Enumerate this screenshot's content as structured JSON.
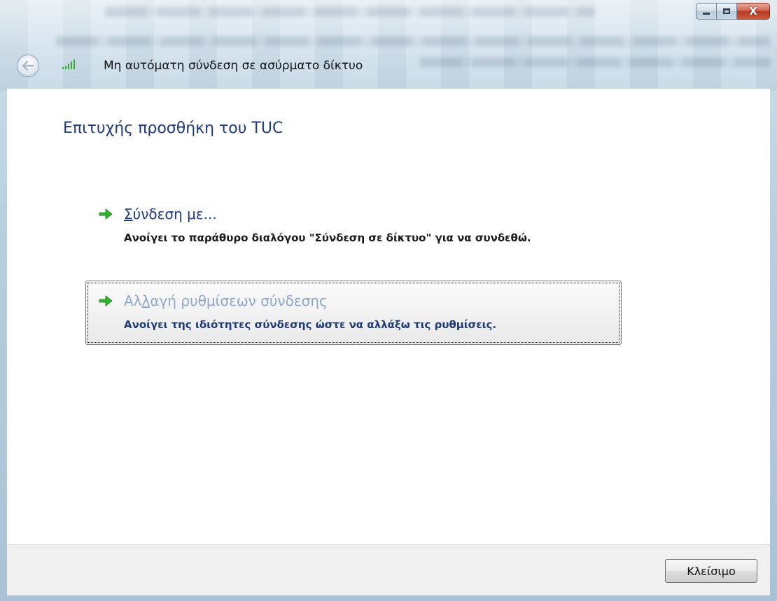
{
  "window": {
    "title": "Μη αυτόματη σύνδεση σε ασύρματο δίκτυο",
    "caption_buttons": [
      "minimize",
      "maximize",
      "close"
    ],
    "close_glyph": "X"
  },
  "nav": {
    "back_icon": "back-arrow-icon",
    "network_icon": "wireless-signal-icon"
  },
  "main": {
    "heading": "Επιτυχής προσθήκη του TUC",
    "commands": [
      {
        "title_underlined": "Σ",
        "title_rest": "ύνδεση με...",
        "description": "Ανοίγει το παράθυρο διαλόγου \"Σύνδεση σε δίκτυο\" για να συνδεθώ."
      },
      {
        "title_pre": "Αλ",
        "title_underlined": "λ",
        "title_rest": "αγή ρυθμίσεων σύνδεσης",
        "description": "Ανοίγει της ιδιότητες σύνδεσης ώστε να αλλάξω τις ρυθμίσεις."
      }
    ]
  },
  "footer": {
    "close_label": "Κλείσιμο"
  },
  "colors": {
    "heading": "#1e3a78",
    "disabled_link": "#8fa6c8",
    "arrow": "#2db52d"
  }
}
